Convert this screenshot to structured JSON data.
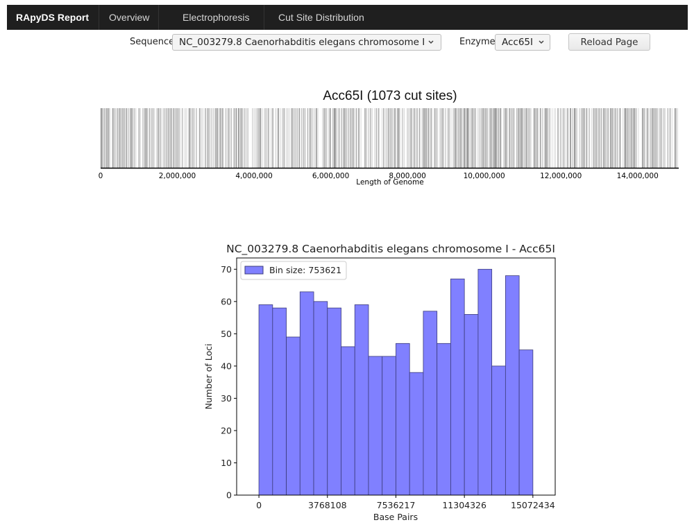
{
  "nav": {
    "brand": "RApyDS Report",
    "items": [
      "Overview",
      "Electrophoresis",
      "Cut Site Distribution"
    ]
  },
  "controls": {
    "sequence_label": "Sequence:",
    "sequence_value": "NC_003279.8 Caenorhabditis elegans chromosome I",
    "enzyme_label": "Enzyme:",
    "enzyme_value": "Acc65I",
    "reload_label": "Reload Page"
  },
  "cut_map": {
    "title": "Acc65I (1073 cut sites)",
    "xlabel": "Length of Genome",
    "ticks": [
      "0",
      "2,000,000",
      "4,000,000",
      "6,000,000",
      "8,000,000",
      "10,000,000",
      "12,000,000",
      "14,000,000"
    ],
    "tick_values": [
      0,
      2000000,
      4000000,
      6000000,
      8000000,
      10000000,
      12000000,
      14000000
    ],
    "genome_length": 15072434,
    "cut_sites": 1073,
    "colors": {
      "line": "#777777",
      "axis": "#000000"
    }
  },
  "chart_data": {
    "type": "bar",
    "title": "NC_003279.8 Caenorhabditis elegans chromosome I - Acc65I",
    "xlabel": "Base Pairs",
    "ylabel": "Number of Loci",
    "legend": "Bin size: 753621",
    "legend_position": "top-left",
    "bin_size": 753621,
    "values": [
      59,
      58,
      49,
      63,
      60,
      58,
      46,
      59,
      43,
      43,
      47,
      38,
      57,
      47,
      67,
      56,
      70,
      40,
      68,
      45
    ],
    "xticks": [
      "0",
      "3768108",
      "7536217",
      "11304326",
      "15072434"
    ],
    "xtick_values": [
      0,
      3768108,
      7536217,
      11304326,
      15072434
    ],
    "yticks": [
      "0",
      "10",
      "20",
      "30",
      "40",
      "50",
      "60",
      "70"
    ],
    "ylim": [
      0,
      73.5
    ],
    "xlim": [
      0,
      15072434
    ],
    "grid": false,
    "colors": {
      "bar_fill": "#8080ff",
      "bar_edge": "#3b3b7a"
    }
  }
}
